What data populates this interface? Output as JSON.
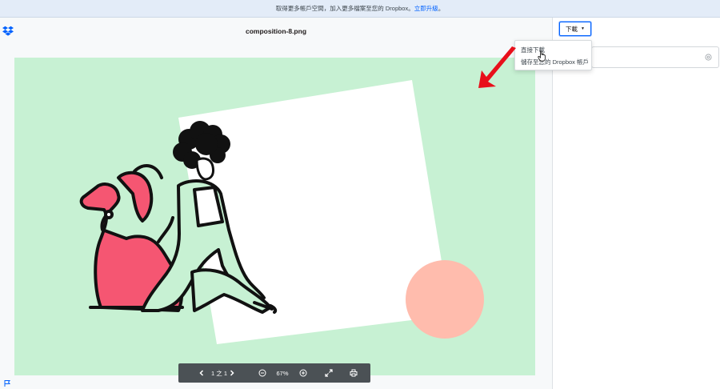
{
  "banner": {
    "text": "取得更多帳戶空間，加入更多檔案至您的 Dropbox。",
    "link": "立即升級",
    "tail": "。"
  },
  "preview": {
    "filename": "composition-8.png"
  },
  "toolbar": {
    "page_indicator": "1 之 1",
    "zoom": "67%"
  },
  "sidebar": {
    "download_label": "下載"
  },
  "download_menu": {
    "items": [
      "直接下載",
      "儲存至您的 Dropbox 帳戶"
    ]
  },
  "colors": {
    "canvas_bg": "#c7f1d3",
    "dog": "#f55672",
    "circle": "#ffbcad",
    "arrow": "#e8101b",
    "accent": "#0061fe"
  }
}
